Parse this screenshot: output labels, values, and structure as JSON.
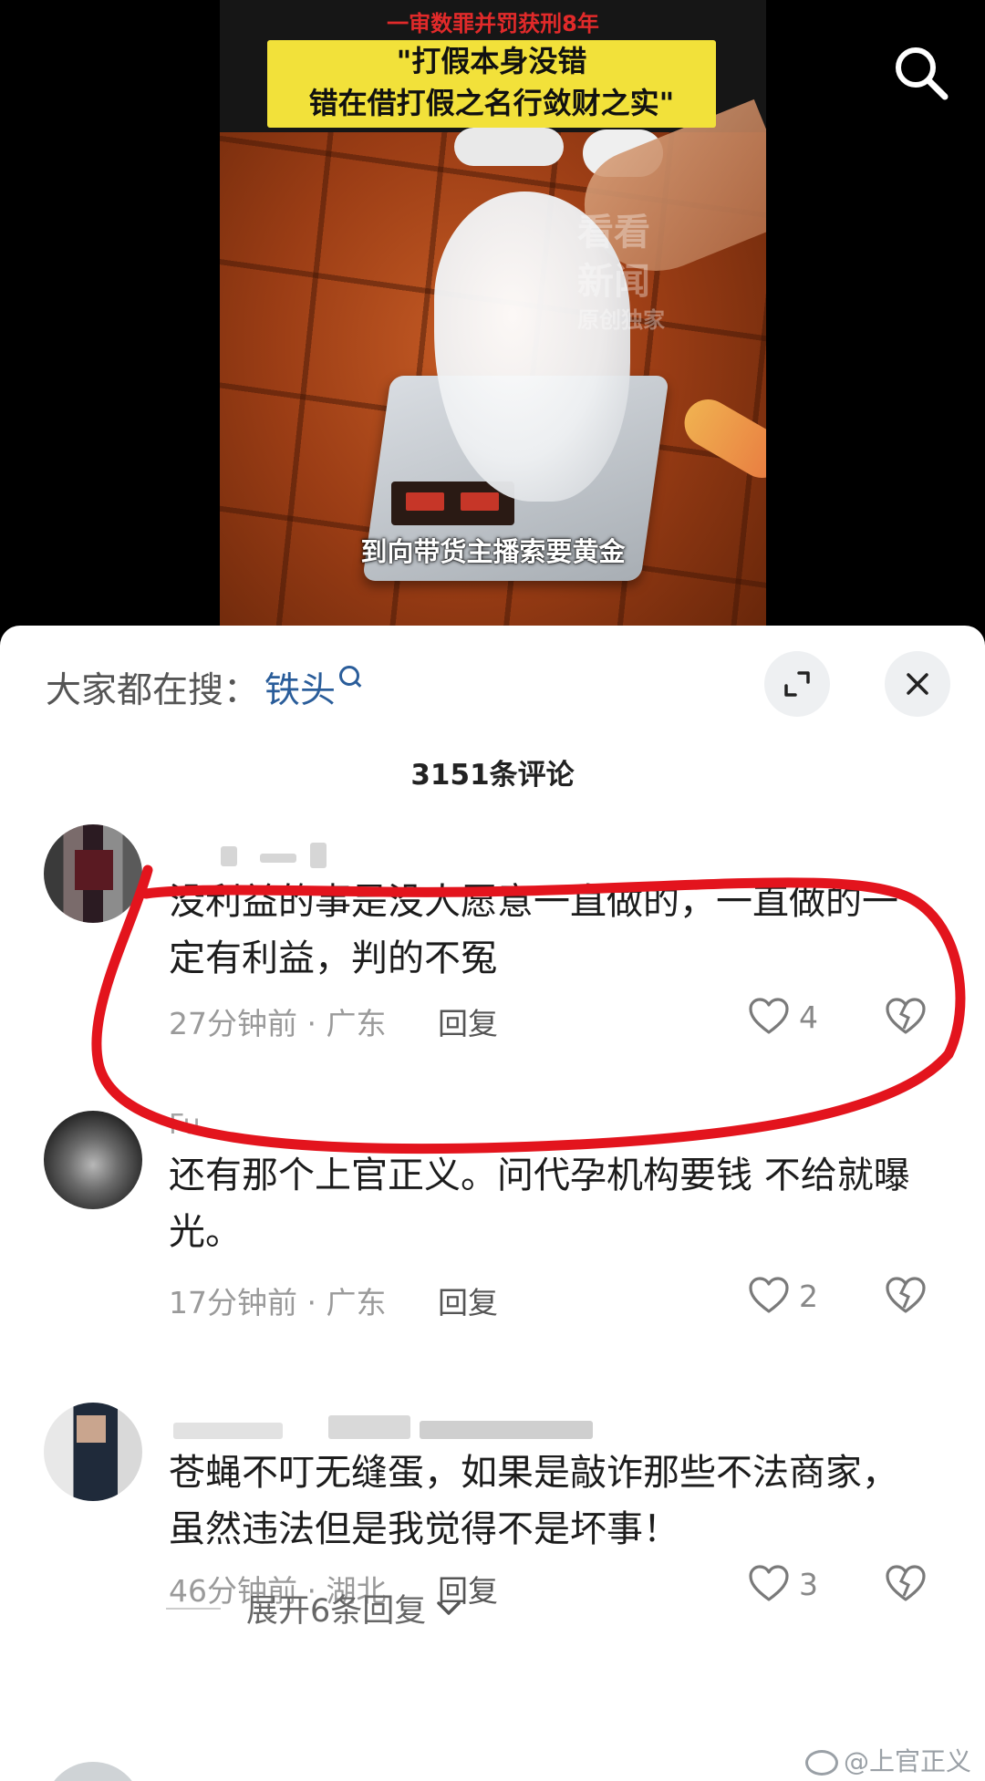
{
  "video": {
    "caption_line1": "一审数罪并罚获刑8年",
    "caption_box_line1": "\"打假本身没错",
    "caption_box_line2": "错在借打假之名行敛财之实\"",
    "watermark_line1": "看看",
    "watermark_line2": "新闻",
    "watermark_line3": "原创独家",
    "subtitle": "到向带货主播索要黄金",
    "top_icon": "search-icon"
  },
  "sheet": {
    "hot_search_label": "大家都在搜：",
    "hot_search_keyword": "铁头",
    "expand_icon": "expand-icon",
    "close_icon": "close-icon",
    "comment_count": "3151条评论"
  },
  "comments": [
    {
      "author": "",
      "text": "没利益的事是没人愿意一直做的，一直做的一定有利益，判的不冤",
      "time": "27分钟前",
      "location": "广东",
      "reply_label": "回复",
      "likes": "4"
    },
    {
      "author": "Fu",
      "text": "还有那个上官正义。问代孕机构要钱 不给就曝光。",
      "time": "17分钟前",
      "location": "广东",
      "reply_label": "回复",
      "likes": "2"
    },
    {
      "author": "",
      "text": "苍蝇不叮无缝蛋，如果是敲诈那些不法商家，虽然违法但是我觉得不是坏事！",
      "time": "46分钟前",
      "location": "湖北",
      "reply_label": "回复",
      "likes": "3"
    }
  ],
  "expand_replies": "展开6条回复",
  "credit": "@上官正义",
  "colors": {
    "highlight_ring": "#e3141d",
    "link_blue": "#2a5d9a",
    "caption_yellow": "#f2e13a",
    "caption_red": "#e12a2a"
  }
}
